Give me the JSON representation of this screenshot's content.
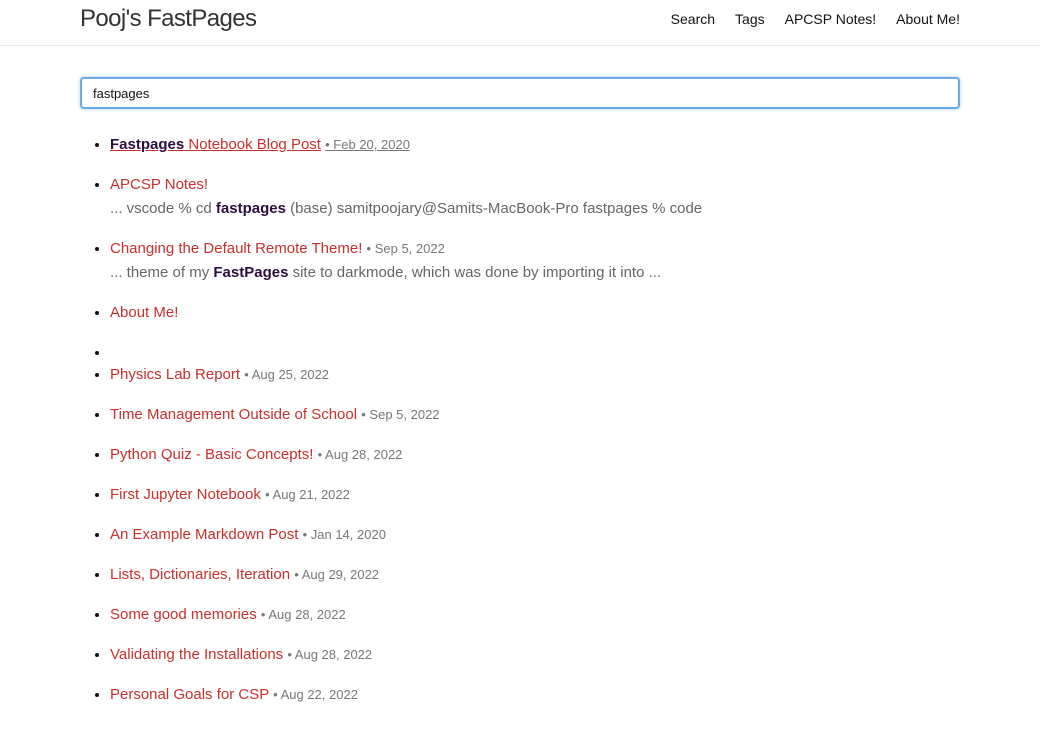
{
  "header": {
    "site_title": "Pooj's FastPages",
    "nav": [
      "Search",
      "Tags",
      "APCSP Notes!",
      "About Me!"
    ]
  },
  "search": {
    "value": "fastpages"
  },
  "results": [
    {
      "title_hl": "Fastpages",
      "title_rest": " Notebook Blog Post",
      "date": "• Feb 20, 2020"
    },
    {
      "title": "APCSP Notes!",
      "excerpt_pre": "... vscode % cd ",
      "excerpt_hl": "fastpages",
      "excerpt_post": " (base) samitpoojary@Samits-MacBook-Pro fastpages % code"
    },
    {
      "title": "Changing the Default Remote Theme!",
      "date": "• Sep 5, 2022",
      "excerpt_pre": "... theme of my ",
      "excerpt_hl": "FastPages",
      "excerpt_post": " site to darkmode, which was done by importing it into ..."
    },
    {
      "title": "About Me!"
    },
    {},
    {
      "title": "Physics Lab Report",
      "date": "• Aug 25, 2022"
    },
    {
      "title": "Time Management Outside of School",
      "date": "• Sep 5, 2022"
    },
    {
      "title": "Python Quiz - Basic Concepts!",
      "date": "• Aug 28, 2022"
    },
    {
      "title": "First Jupyter Notebook",
      "date": "• Aug 21, 2022"
    },
    {
      "title": "An Example Markdown Post",
      "date": "• Jan 14, 2020"
    },
    {
      "title": "Lists, Dictionaries, Iteration",
      "date": "• Aug 29, 2022"
    },
    {
      "title": "Some good memories",
      "date": "• Aug 28, 2022"
    },
    {
      "title": "Validating the Installations",
      "date": "• Aug 28, 2022"
    },
    {
      "title": "Personal Goals for CSP",
      "date": "• Aug 22, 2022"
    }
  ],
  "colors": {
    "link": "#c9302c",
    "highlight": "#2e0d3f",
    "focus_border": "#6aa9e8"
  }
}
